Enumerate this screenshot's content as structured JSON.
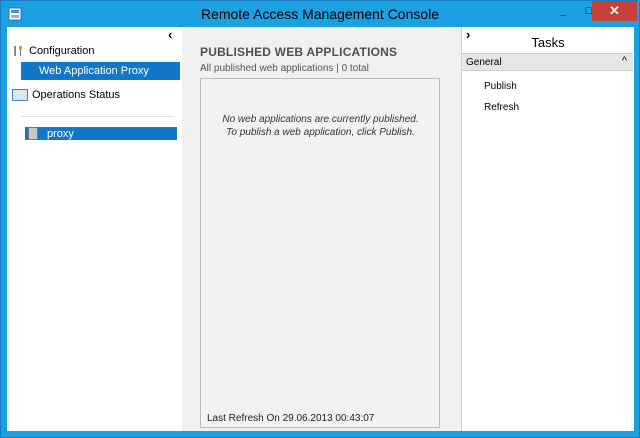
{
  "window": {
    "title": "Remote Access Management Console",
    "controls": {
      "minimize": "_",
      "maximize": "□",
      "close": "✕"
    }
  },
  "left_pane": {
    "collapse_glyph": "‹",
    "items": [
      {
        "label": "Configuration",
        "icon": "tools-icon"
      },
      {
        "label": "Web Application Proxy",
        "selected": true
      },
      {
        "label": "Operations Status",
        "icon": "operations-status-icon"
      }
    ],
    "server": {
      "label": "proxy",
      "icon": "server-icon"
    }
  },
  "middle_pane": {
    "title": "PUBLISHED WEB APPLICATIONS",
    "subtitle": "All published web applications | 0 total",
    "empty_message": "No web applications are currently published. To publish a web application, click Publish.",
    "last_refresh": "Last Refresh On 29.06.2013 00:43:07"
  },
  "right_pane": {
    "collapse_glyph": "›",
    "title": "Tasks",
    "group": {
      "label": "General",
      "caret": "^"
    },
    "tasks": [
      "Publish",
      "Refresh"
    ]
  },
  "colors": {
    "accent": "#1ba1e2",
    "selection": "#1178c9",
    "close": "#c7413a"
  }
}
